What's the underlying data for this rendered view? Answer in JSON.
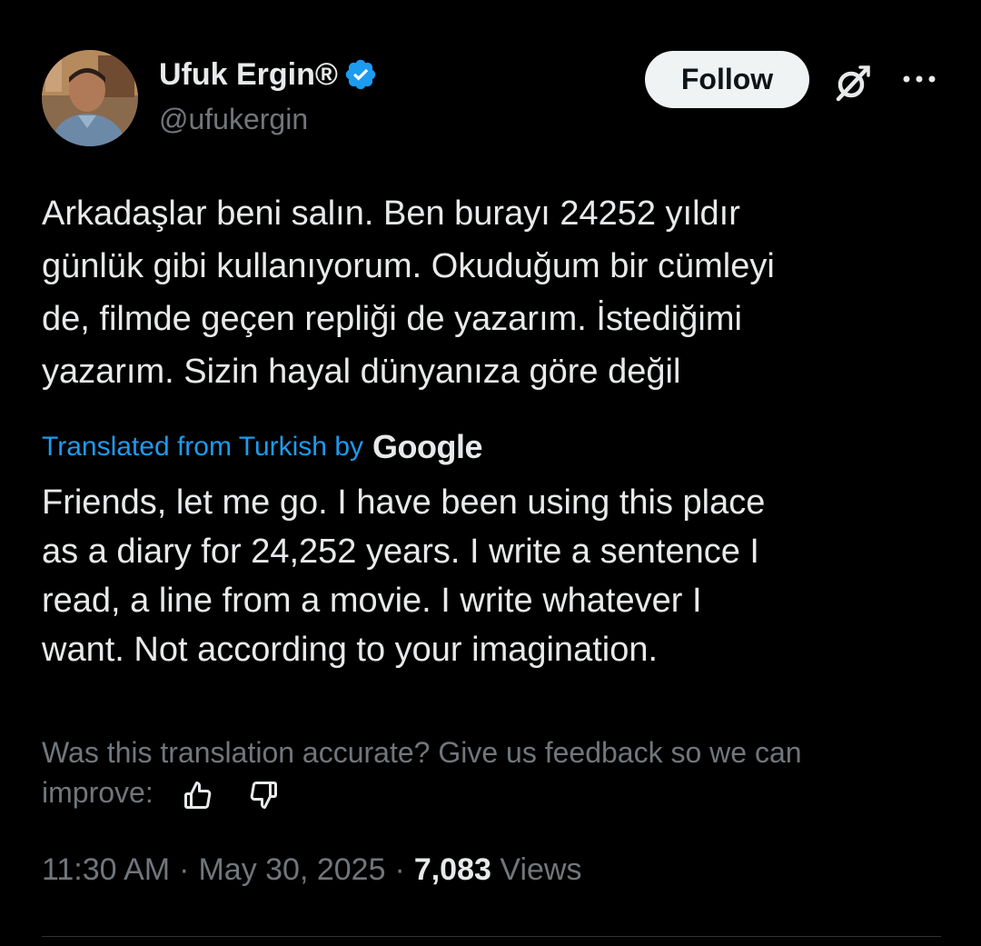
{
  "author": {
    "display_name": "Ufuk Ergin®",
    "handle": "@ufukergin",
    "verified": true,
    "avatar_icon": "avatar-photo"
  },
  "actions": {
    "follow_label": "Follow",
    "grok_icon": "grok-icon",
    "more_icon": "more-icon"
  },
  "tweet": {
    "text_lines": [
      "Arkadaşlar beni salın. Ben burayı 24252 yıldır",
      "günlük gibi kullanıyorum. Okuduğum bir cümleyi",
      "de, filmde geçen repliği de yazarım. İstediğimi",
      "yazarım. Sizin hayal dünyanıza göre değil"
    ]
  },
  "translation": {
    "label": "Translated from Turkish by",
    "provider": "Google",
    "text_lines": [
      "Friends, let me go. I have been using this place",
      "as a diary for 24,252 years. I write a sentence I",
      "read, a line from a movie. I write whatever I",
      "want. Not according to your imagination."
    ],
    "feedback_line1": "Was this translation accurate? Give us feedback so we can",
    "feedback_line2": "improve:",
    "thumbs_up_icon": "thumbs-up-icon",
    "thumbs_down_icon": "thumbs-down-icon"
  },
  "meta": {
    "time": "11:30 AM",
    "separator": "·",
    "date": "May 30, 2025",
    "views_count": "7,083",
    "views_label": "Views"
  },
  "colors": {
    "background": "#000000",
    "text": "#e7e9ea",
    "secondary": "#71767b",
    "link": "#1d9bf0",
    "verified": "#1d9bf0",
    "follow_bg": "#eff3f4"
  }
}
